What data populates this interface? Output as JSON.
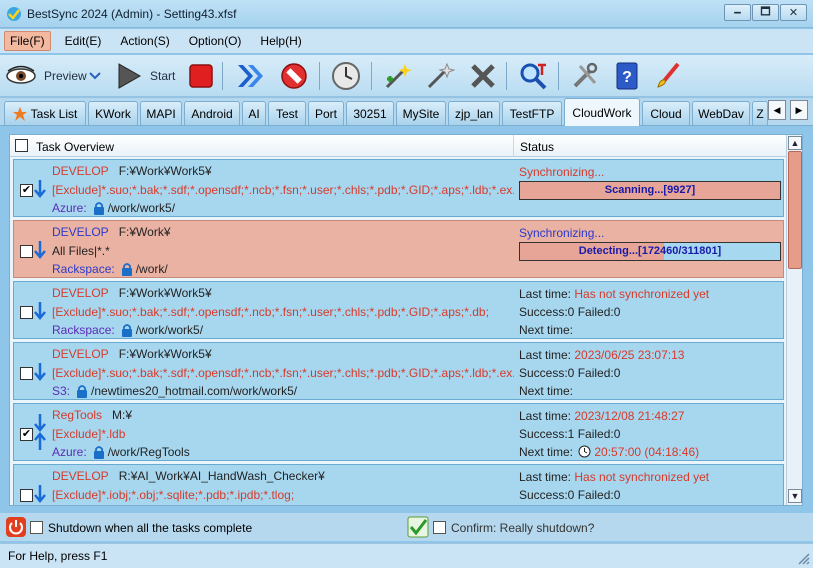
{
  "window": {
    "title": "BestSync 2024 (Admin) - Setting43.xfsf",
    "buttons": [
      "🗕",
      "🗖",
      "✕"
    ]
  },
  "menu": {
    "items": [
      {
        "label": "File(F)",
        "active": true
      },
      {
        "label": "Edit(E)",
        "active": false
      },
      {
        "label": "Action(S)",
        "active": false
      },
      {
        "label": "Option(O)",
        "active": false
      },
      {
        "label": "Help(H)",
        "active": false
      }
    ]
  },
  "toolbar": {
    "preview_label": "Preview",
    "start_label": "Start"
  },
  "tabs": {
    "items": [
      "Task List",
      "KWork",
      "MAPI",
      "Android",
      "AI",
      "Test",
      "Port",
      "30251",
      "MySite",
      "zjp_lan",
      "TestFTP",
      "CloudWork",
      "Cloud",
      "WebDav",
      "Z"
    ],
    "active": "CloudWork",
    "prev_arrow": "◀",
    "next_arrow": "▶"
  },
  "list": {
    "header": {
      "task": "Task Overview",
      "status": "Status"
    },
    "rows": [
      {
        "checked": true,
        "selected": false,
        "name": "DEVELOP",
        "path": "F:¥Work¥Work5¥",
        "filter_tag": "[Exclude]",
        "filter": "*.suo;*.bak;*.sdf;*.opensdf;*.ncb;*.fsn;*.user;*.chls;*.pdb;*.GID;*.aps;*.ldb;*.ex...",
        "service": "Azure:",
        "remote": "/work/work5/",
        "status_title": "Synchronizing...",
        "progress_text": "Scanning...[9927]",
        "progress": 1.0
      },
      {
        "checked": false,
        "selected": true,
        "name": "DEVELOP",
        "path": "F:¥Work¥",
        "filter_tag": "",
        "filter": "All Files|*.*",
        "service": "Rackspace:",
        "remote": "/work/",
        "status_title": "Synchronizing...",
        "progress_text": "Detecting...[172460/311801]",
        "progress": 0.553
      },
      {
        "checked": false,
        "selected": false,
        "name": "DEVELOP",
        "path": "F:¥Work¥Work5¥",
        "filter_tag": "[Exclude]",
        "filter": "*.suo;*.bak;*.sdf;*.opensdf;*.ncb;*.fsn;*.user;*.chls;*.pdb;*.GID;*.aps;*.db;",
        "service": "Rackspace:",
        "remote": "/work/work5/",
        "last_label": "Last time: ",
        "last_value": "Has not synchronized yet",
        "counts": "Success:0 Failed:0",
        "next_label": "Next time: ",
        "next_value": ""
      },
      {
        "checked": false,
        "selected": false,
        "name": "DEVELOP",
        "path": "F:¥Work¥Work5¥",
        "filter_tag": "[Exclude]",
        "filter": "*.suo;*.bak;*.sdf;*.opensdf;*.ncb;*.fsn;*.user;*.chls;*.pdb;*.GID;*.aps;*.ldb;*.ex...",
        "service": "S3:",
        "remote": "/newtimes20_hotmail.com/work/work5/",
        "last_label": "Last time: ",
        "last_value": "2023/06/25 23:07:13",
        "counts": "Success:0 Failed:0",
        "next_label": "Next time: ",
        "next_value": ""
      },
      {
        "checked": true,
        "selected": false,
        "name": "RegTools",
        "path": "M:¥",
        "filter_tag": "[Exclude]",
        "filter": "*.ldb",
        "service": "Azure:",
        "remote": "/work/RegTools",
        "last_label": "Last time: ",
        "last_value": "2023/12/08 21:48:27",
        "counts": "Success:1 Failed:0",
        "next_label": "Next time: ",
        "next_value": "20:57:00 (04:18:46)"
      },
      {
        "checked": false,
        "selected": false,
        "name": "DEVELOP",
        "path": "R:¥AI_Work¥AI_HandWash_Checker¥",
        "filter_tag": "[Exclude]",
        "filter": "*.iobj;*.obj;*.sqlite;*.pdb;*.ipdb;*.tlog;",
        "service": "",
        "remote": "",
        "last_label": "Last time: ",
        "last_value": "Has not synchronized yet",
        "counts": "Success:0 Failed:0",
        "next_label": "",
        "next_value": ""
      }
    ]
  },
  "bottom": {
    "shutdown_label": "Shutdown when all the tasks complete",
    "confirm_label": "Confirm: Really shutdown?"
  },
  "statusbar": {
    "text": "For Help, press F1"
  },
  "colors": {
    "accent_red": "#d63a2a",
    "service_blue": "#5b2bb5",
    "selected_row": "#eab2a2",
    "row_bg": "#a7d7ef"
  }
}
